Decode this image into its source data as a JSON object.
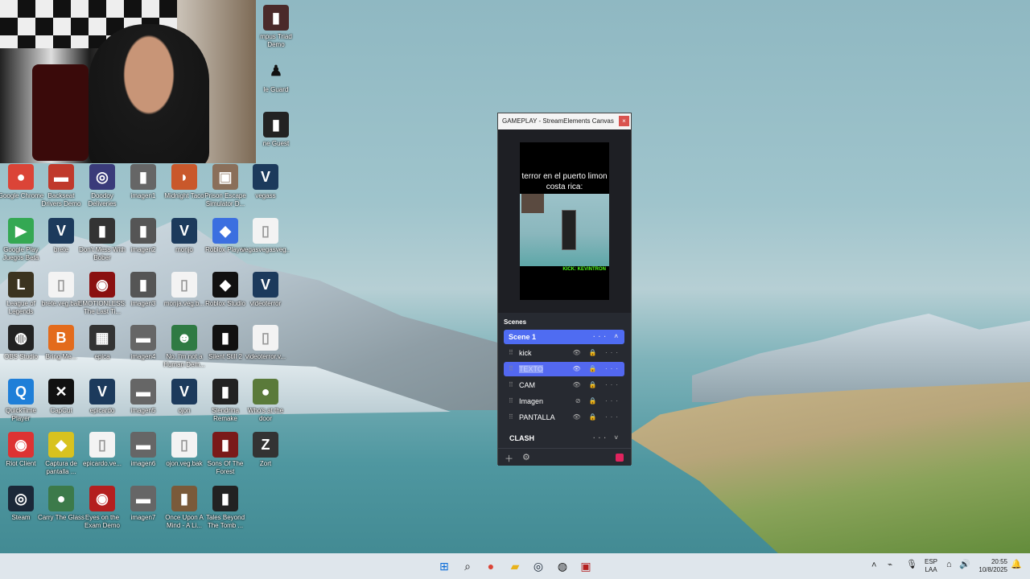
{
  "desktop": {
    "icons": [
      {
        "label": "Google Chrome",
        "glyph": "●",
        "color": "#db4437"
      },
      {
        "label": "Backseat Drivers Demo",
        "glyph": "▬",
        "color": "#c0392b"
      },
      {
        "label": "Doodoy Deliveries",
        "glyph": "◎",
        "color": "#3a3b7a"
      },
      {
        "label": "imagen1",
        "glyph": "▮",
        "color": "#666"
      },
      {
        "label": "Midnight Taco",
        "glyph": "◗",
        "color": "#c9582b"
      },
      {
        "label": "Prison Escape Simulator D...",
        "glyph": "▣",
        "color": "#8a6f5a"
      },
      {
        "label": "vegass",
        "glyph": "V",
        "color": "#1c3a5c"
      },
      {
        "label": "Google Play Juegos Beta",
        "glyph": "▶",
        "color": "#34a853"
      },
      {
        "label": "brete",
        "glyph": "V",
        "color": "#1c3a5c"
      },
      {
        "label": "Don't Mess With Bober",
        "glyph": "▮",
        "color": "#333"
      },
      {
        "label": "imagen2",
        "glyph": "▮",
        "color": "#555"
      },
      {
        "label": "monjo",
        "glyph": "V",
        "color": "#1c3a5c"
      },
      {
        "label": "Roblox Player",
        "glyph": "◆",
        "color": "#3b6fe0"
      },
      {
        "label": "vegasvegasveg...",
        "glyph": "▯",
        "color": "#f3f3f3"
      },
      {
        "label": "League of Legends",
        "glyph": "L",
        "color": "#3c3420"
      },
      {
        "label": "brete.veg.bak",
        "glyph": "▯",
        "color": "#f3f3f3"
      },
      {
        "label": "EMOTIONLESS: The Last Ti...",
        "glyph": "◉",
        "color": "#8a1010"
      },
      {
        "label": "imagen3",
        "glyph": "▮",
        "color": "#555"
      },
      {
        "label": "monja.veg.b...",
        "glyph": "▯",
        "color": "#f3f3f3"
      },
      {
        "label": "Roblox Studio",
        "glyph": "◆",
        "color": "#111"
      },
      {
        "label": "videoterror",
        "glyph": "V",
        "color": "#1c3a5c"
      },
      {
        "label": "OBS Studio",
        "glyph": "◍",
        "color": "#222"
      },
      {
        "label": "Bring Me...",
        "glyph": "B",
        "color": "#e36b1c"
      },
      {
        "label": "epica",
        "glyph": "▦",
        "color": "#333"
      },
      {
        "label": "imagen4",
        "glyph": "▬",
        "color": "#666"
      },
      {
        "label": "No, I'm not a Human Dem...",
        "glyph": "☻",
        "color": "#2f7a43"
      },
      {
        "label": "Silent Still 2",
        "glyph": "▮",
        "color": "#111"
      },
      {
        "label": "videoterror.v...",
        "glyph": "▯",
        "color": "#f3f3f3"
      },
      {
        "label": "QuickTime Player",
        "glyph": "Q",
        "color": "#1f7fd8"
      },
      {
        "label": "CapCut",
        "glyph": "✕",
        "color": "#111"
      },
      {
        "label": "epicardo",
        "glyph": "V",
        "color": "#1c3a5c"
      },
      {
        "label": "imagen5",
        "glyph": "▬",
        "color": "#666"
      },
      {
        "label": "ojon",
        "glyph": "V",
        "color": "#1c3a5c"
      },
      {
        "label": "Slendrina Remake",
        "glyph": "▮",
        "color": "#222"
      },
      {
        "label": "Who's at the door",
        "glyph": "●",
        "color": "#5a7a3a"
      },
      {
        "label": "Riot Client",
        "glyph": "◉",
        "color": "#d33"
      },
      {
        "label": "Captura de pantalla ...",
        "glyph": "◆",
        "color": "#d8c21f"
      },
      {
        "label": "epicardo.ve...",
        "glyph": "▯",
        "color": "#f3f3f3"
      },
      {
        "label": "imagen6",
        "glyph": "▬",
        "color": "#666"
      },
      {
        "label": "ojon.veg.bak",
        "glyph": "▯",
        "color": "#f3f3f3"
      },
      {
        "label": "Sons Of The Forest",
        "glyph": "▮",
        "color": "#7a1a1a"
      },
      {
        "label": "Zort",
        "glyph": "Z",
        "color": "#333"
      },
      {
        "label": "Steam",
        "glyph": "◎",
        "color": "#1b2838"
      },
      {
        "label": "Carry The Glass",
        "glyph": "●",
        "color": "#3c7a4a"
      },
      {
        "label": "Eyes on the Exam Demo",
        "glyph": "◉",
        "color": "#b41f1f"
      },
      {
        "label": "imagen7",
        "glyph": "▬",
        "color": "#666"
      },
      {
        "label": "Once Upon A Mind - A Li...",
        "glyph": "▮",
        "color": "#7a5a3a"
      },
      {
        "label": "Tales Beyond The Tomb ...",
        "glyph": "▮",
        "color": "#222"
      }
    ],
    "side_icons": [
      {
        "label": "mpus Triad Demo"
      },
      {
        "label": "le Guard"
      },
      {
        "label": "ne Guest"
      }
    ]
  },
  "canvas": {
    "title": "GAMEPLAY - StreamElements Canvas",
    "close": "×",
    "preview_text": "terror en el puerto limon costa rica:",
    "preview_kick": "KICK: KEVINTRON",
    "scenes_label": "Scenes",
    "scene_name": "Scene 1",
    "layers": [
      "kick",
      "TEXTO",
      "CAM",
      "Imagen",
      "PANTALLA"
    ],
    "group": "CLASH"
  },
  "taskbar": {
    "lang": "ESP",
    "lang2": "LAA",
    "time": "20:55",
    "date": "10/8/2025"
  }
}
